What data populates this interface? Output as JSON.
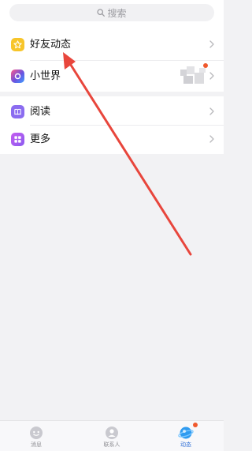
{
  "search": {
    "placeholder": "搜索"
  },
  "menu": {
    "friends_feed": {
      "label": "好友动态",
      "icon": "star-icon",
      "color": "#f5c518"
    },
    "small_world": {
      "label": "小世界",
      "icon": "planet-icon",
      "color": "#6a52e0"
    },
    "reading": {
      "label": "阅读",
      "icon": "book-icon",
      "color": "#8b6cf0"
    },
    "more": {
      "label": "更多",
      "icon": "grid-icon",
      "color": "#a35cf0"
    }
  },
  "tabbar": {
    "tabs": [
      {
        "label": "消息",
        "icon": "chat-icon"
      },
      {
        "label": "联系人",
        "icon": "contact-icon"
      },
      {
        "label": "动态",
        "icon": "planet-tab-icon",
        "active": true
      }
    ]
  },
  "annotation": {
    "type": "red-arrow",
    "color": "#e8463c",
    "points_to": "好友动态"
  }
}
